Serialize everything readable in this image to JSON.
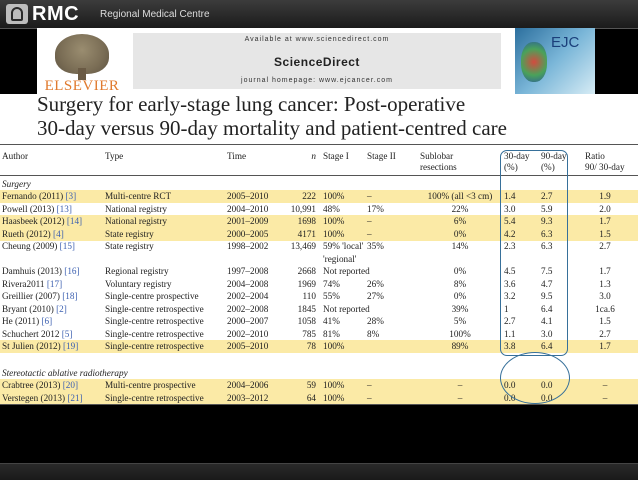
{
  "brand": {
    "name": "RMC",
    "subtitle": "Regional Medical Centre"
  },
  "journal": {
    "publisher": "ELSEVIER",
    "available": "Available at www.sciencedirect.com",
    "name": "ScienceDirect",
    "homepage": "journal homepage: www.ejcancer.com",
    "cover_title": "EJC"
  },
  "title": {
    "line1": "Surgery for early-stage lung cancer: Post-operative",
    "line2": "30-day versus 90-day mortality and patient-centred care"
  },
  "table": {
    "headers": {
      "author": "Author",
      "type": "Type",
      "time": "Time",
      "n": "n",
      "stage1": "Stage I",
      "stage2": "Stage II",
      "sublobar1": "Sublobar",
      "sublobar2": "resections",
      "d30_1": "30-day",
      "d30_2": "(%)",
      "d90_1": "90-day",
      "d90_2": "(%)",
      "ratio1": "Ratio",
      "ratio2": "90/ 30-day"
    },
    "section_surgery": "Surgery",
    "section_sabr": "Stereotactic ablative radiotherapy",
    "rows": [
      {
        "author": "Fernando (2011)",
        "ref": "[3]",
        "type": "Multi-centre RCT",
        "time": "2005–2010",
        "n": "222",
        "s1": "100%",
        "s2": "–",
        "sub": "100% (all <3 cm)",
        "d30": "1.4",
        "d90": "2.7",
        "ratio": "1.9",
        "highlight": true
      },
      {
        "author": "Powell (2013)",
        "ref": "[13]",
        "type": "National registry",
        "time": "2004–2010",
        "n": "10,991",
        "s1": "48%",
        "s2": "17%",
        "sub": "22%",
        "d30": "3.0",
        "d90": "5.9",
        "ratio": "2.0",
        "highlight": false
      },
      {
        "author": "Haasbeek (2012)",
        "ref": "[14]",
        "type": "National registry",
        "time": "2001–2009",
        "n": "1698",
        "s1": "100%",
        "s2": "–",
        "sub": "6%",
        "d30": "5.4",
        "d90": "9.3",
        "ratio": "1.7",
        "highlight": true
      },
      {
        "author": "Rueth (2012)",
        "ref": "[4]",
        "type": "State registry",
        "time": "2000–2005",
        "n": "4171",
        "s1": "100%",
        "s2": "–",
        "sub": "0%",
        "d30": "4.2",
        "d90": "6.3",
        "ratio": "1.5",
        "highlight": true
      },
      {
        "author": "Cheung (2009)",
        "ref": "[15]",
        "type": "State registry",
        "time": "1998–2002",
        "n": "13,469",
        "s1": "59% 'local'",
        "s2": "35%",
        "sub": "14%",
        "d30": "2.3",
        "d90": "6.3",
        "ratio": "2.7",
        "highlight": false,
        "s1b": "'regional'"
      },
      {
        "author": "Damhuis (2013)",
        "ref": "[16]",
        "type": "Regional registry",
        "time": "1997–2008",
        "n": "2668",
        "s1": "Not reported",
        "s2": "",
        "sub": "0%",
        "d30": "4.5",
        "d90": "7.5",
        "ratio": "1.7",
        "highlight": false
      },
      {
        "author": "Rivera2011",
        "ref": "[17]",
        "type": "Voluntary registry",
        "time": "2004–2008",
        "n": "1969",
        "s1": "74%",
        "s2": "26%",
        "sub": "8%",
        "d30": "3.6",
        "d90": "4.7",
        "ratio": "1.3",
        "highlight": false
      },
      {
        "author": "Greillier (2007)",
        "ref": "[18]",
        "type": "Single-centre prospective",
        "time": "2002–2004",
        "n": "110",
        "s1": "55%",
        "s2": "27%",
        "sub": "0%",
        "d30": "3.2",
        "d90": "9.5",
        "ratio": "3.0",
        "highlight": false
      },
      {
        "author": "Bryant (2010)",
        "ref": "[2]",
        "type": "Single-centre retrospective",
        "time": "2002–2008",
        "n": "1845",
        "s1": "Not reported",
        "s2": "",
        "sub": "39%",
        "d30": "1",
        "d90": "6.4",
        "ratio": "1ca.6",
        "highlight": false
      },
      {
        "author": "He (2011)",
        "ref": "[6]",
        "type": "Single-centre retrospective",
        "time": "2000–2007",
        "n": "1058",
        "s1": "41%",
        "s2": "28%",
        "sub": "5%",
        "d30": "2.7",
        "d90": "4.1",
        "ratio": "1.5",
        "highlight": false
      },
      {
        "author": "Schuchert 2012",
        "ref": "[5]",
        "type": "Single-centre retrospective",
        "time": "2002–2010",
        "n": "785",
        "s1": "81%",
        "s2": "8%",
        "sub": "100%",
        "d30": "1.1",
        "d90": "3.0",
        "ratio": "2.7",
        "highlight": false
      },
      {
        "author": "St Julien (2012)",
        "ref": "[19]",
        "type": "Single-centre retrospective",
        "time": "2005–2010",
        "n": "78",
        "s1": "100%",
        "s2": "",
        "sub": "89%",
        "d30": "3.8",
        "d90": "6.4",
        "ratio": "1.7",
        "highlight": true
      }
    ],
    "sabr_rows": [
      {
        "author": "Crabtree (2013)",
        "ref": "[20]",
        "type": "Multi-centre prospective",
        "time": "2004–2006",
        "n": "59",
        "s1": "100%",
        "s2": "–",
        "sub": "–",
        "d30": "0.0",
        "d90": "0.0",
        "ratio": "–",
        "highlight": true
      },
      {
        "author": "Verstegen (2013)",
        "ref": "[21]",
        "type": "Single-centre retrospective",
        "time": "2003–2012",
        "n": "64",
        "s1": "100%",
        "s2": "–",
        "sub": "–",
        "d30": "0.0",
        "d90": "0.0",
        "ratio": "–",
        "highlight": true
      }
    ]
  },
  "colors": {
    "highlight_row": "#fbeaa6",
    "annotation": "#37709a",
    "citation": "#3b5fb0",
    "publisher": "#e07a2e"
  }
}
